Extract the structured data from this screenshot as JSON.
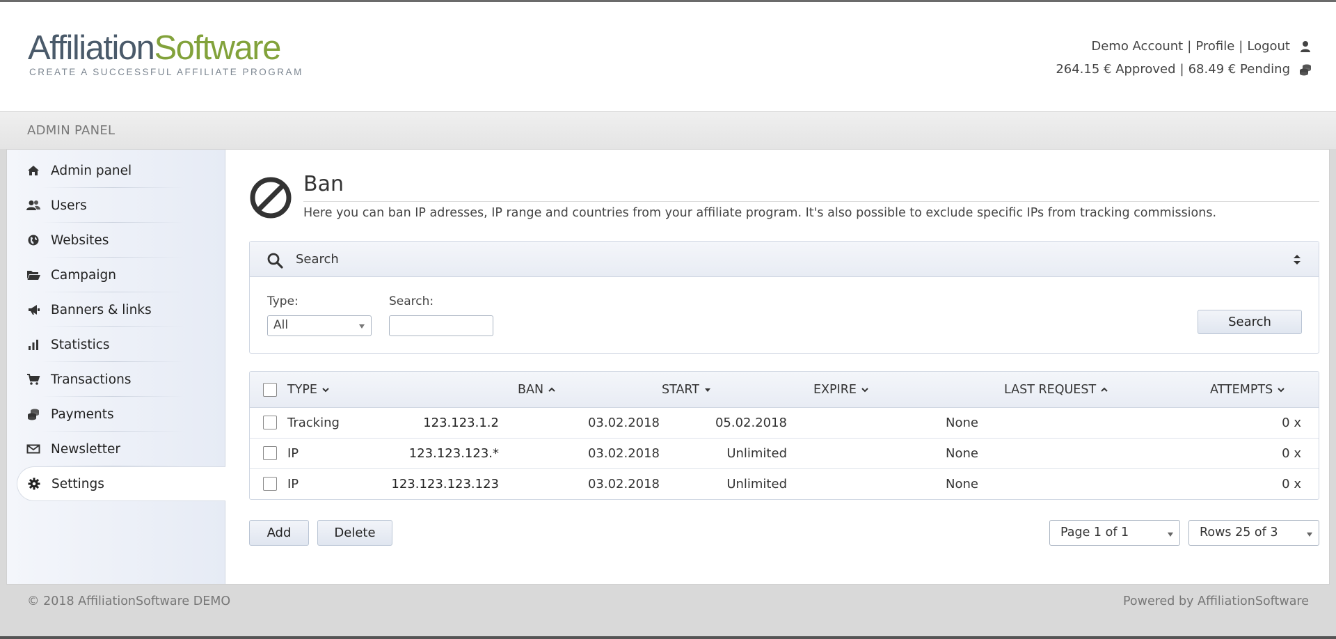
{
  "header": {
    "logo": {
      "part1": "Affiliation",
      "part2": "Software",
      "tagline": "CREATE A SUCCESSFUL AFFILIATE PROGRAM"
    },
    "user_links": {
      "account": "Demo Account",
      "profile": "Profile",
      "logout": "Logout",
      "separator": "|"
    },
    "balance": {
      "approved": "264.15 € Approved",
      "pending": "68.49 € Pending"
    }
  },
  "panel": {
    "title": "ADMIN PANEL"
  },
  "sidebar": {
    "items": [
      {
        "label": "Admin panel",
        "icon": "home-icon"
      },
      {
        "label": "Users",
        "icon": "users-icon"
      },
      {
        "label": "Websites",
        "icon": "globe-icon"
      },
      {
        "label": "Campaign",
        "icon": "folder-icon"
      },
      {
        "label": "Banners & links",
        "icon": "megaphone-icon"
      },
      {
        "label": "Statistics",
        "icon": "bar-chart-icon"
      },
      {
        "label": "Transactions",
        "icon": "cart-icon"
      },
      {
        "label": "Payments",
        "icon": "coins-icon"
      },
      {
        "label": "Newsletter",
        "icon": "mail-icon"
      },
      {
        "label": "Settings",
        "icon": "gear-icon",
        "active": true
      }
    ]
  },
  "page": {
    "title": "Ban",
    "description": "Here you can ban IP adresses, IP range and countries from your affiliate program. It's also possible to exclude specific IPs from tracking commissions."
  },
  "search": {
    "header": "Search",
    "type_label": "Type:",
    "type_value": "All",
    "search_label": "Search:",
    "search_value": "",
    "button": "Search"
  },
  "table": {
    "columns": [
      "TYPE",
      "BAN",
      "START",
      "EXPIRE",
      "LAST REQUEST",
      "ATTEMPTS"
    ],
    "rows": [
      {
        "type": "Tracking",
        "ban": "123.123.1.2",
        "start": "03.02.2018",
        "expire": "05.02.2018",
        "last_request": "None",
        "attempts": "0 x"
      },
      {
        "type": "IP",
        "ban": "123.123.123.*",
        "start": "03.02.2018",
        "expire": "Unlimited",
        "last_request": "None",
        "attempts": "0 x"
      },
      {
        "type": "IP",
        "ban": "123.123.123.123",
        "start": "03.02.2018",
        "expire": "Unlimited",
        "last_request": "None",
        "attempts": "0 x"
      }
    ]
  },
  "actions": {
    "add": "Add",
    "delete": "Delete"
  },
  "pagination": {
    "page": "Page 1 of 1",
    "rows": "Rows 25 of 3"
  },
  "footer": {
    "copyright": "© 2018 AffiliationSoftware DEMO",
    "powered": "Powered by AffiliationSoftware"
  },
  "colors": {
    "brand_dark": "#4a5a6a",
    "brand_green": "#82a23b",
    "sidebar_bg": "#e6ebf5"
  }
}
